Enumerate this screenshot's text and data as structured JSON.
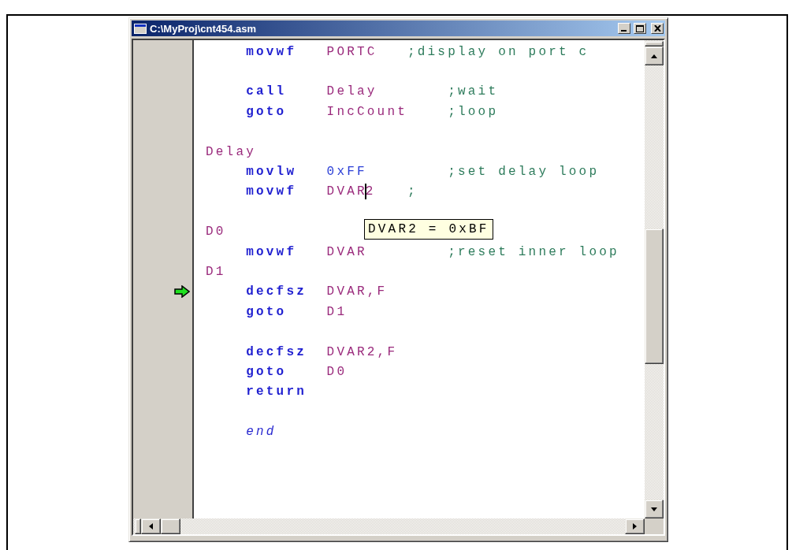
{
  "window": {
    "title": "C:\\MyProj\\cnt454.asm"
  },
  "editor": {
    "lines": [
      {
        "kind": "code",
        "current": false,
        "tokens": [
          {
            "kind": "mnemonic",
            "text": "movwf"
          },
          {
            "kind": "symbol",
            "text": "PORTC"
          },
          {
            "kind": "nearcomment",
            "text": ";display on port c"
          }
        ]
      },
      {
        "kind": "blank",
        "current": false
      },
      {
        "kind": "code",
        "current": false,
        "tokens": [
          {
            "kind": "mnemonic",
            "text": "call"
          },
          {
            "kind": "symbol",
            "text": "Delay"
          },
          {
            "kind": "comment",
            "text": ";wait"
          }
        ]
      },
      {
        "kind": "code",
        "current": false,
        "tokens": [
          {
            "kind": "mnemonic",
            "text": "goto"
          },
          {
            "kind": "symbol",
            "text": "IncCount"
          },
          {
            "kind": "comment",
            "text": ";loop"
          }
        ]
      },
      {
        "kind": "blank",
        "current": false
      },
      {
        "kind": "code",
        "current": false,
        "tokens": [
          {
            "kind": "label",
            "text": "Delay"
          }
        ]
      },
      {
        "kind": "code",
        "current": false,
        "tokens": [
          {
            "kind": "mnemonic",
            "text": "movlw"
          },
          {
            "kind": "number",
            "text": "0xFF"
          },
          {
            "kind": "comment",
            "text": ";set delay loop"
          }
        ]
      },
      {
        "kind": "code",
        "current": false,
        "tokens": [
          {
            "kind": "mnemonic",
            "text": "movwf"
          },
          {
            "kind": "symbol",
            "text": "DVAR",
            "cursor": true,
            "after_cursor": "2"
          },
          {
            "kind": "nearcomment",
            "text": ";"
          }
        ]
      },
      {
        "kind": "blank",
        "current": false
      },
      {
        "kind": "code",
        "current": false,
        "tokens": [
          {
            "kind": "label",
            "text": "D0"
          }
        ]
      },
      {
        "kind": "code",
        "current": false,
        "tokens": [
          {
            "kind": "mnemonic",
            "text": "movwf"
          },
          {
            "kind": "symbol",
            "text": "DVAR"
          },
          {
            "kind": "comment",
            "text": ";reset inner loop"
          }
        ]
      },
      {
        "kind": "code",
        "current": false,
        "tokens": [
          {
            "kind": "label",
            "text": "D1"
          }
        ]
      },
      {
        "kind": "code",
        "current": true,
        "tokens": [
          {
            "kind": "mnemonic",
            "text": "decfsz"
          },
          {
            "kind": "symbol",
            "text": "DVAR,F"
          }
        ]
      },
      {
        "kind": "code",
        "current": false,
        "tokens": [
          {
            "kind": "mnemonic",
            "text": "goto"
          },
          {
            "kind": "symbol",
            "text": "D1"
          }
        ]
      },
      {
        "kind": "blank",
        "current": false
      },
      {
        "kind": "code",
        "current": false,
        "tokens": [
          {
            "kind": "mnemonic",
            "text": "decfsz"
          },
          {
            "kind": "symbol",
            "text": "DVAR2,F"
          }
        ]
      },
      {
        "kind": "code",
        "current": false,
        "tokens": [
          {
            "kind": "mnemonic",
            "text": "goto"
          },
          {
            "kind": "symbol",
            "text": "D0"
          }
        ]
      },
      {
        "kind": "code",
        "current": false,
        "tokens": [
          {
            "kind": "mnemonic",
            "text": "return"
          }
        ]
      },
      {
        "kind": "blank",
        "current": false
      },
      {
        "kind": "code",
        "current": false,
        "tokens": [
          {
            "kind": "directive",
            "text": "end"
          }
        ]
      }
    ],
    "tooltip": {
      "text": "DVAR2 = 0xBF"
    }
  }
}
